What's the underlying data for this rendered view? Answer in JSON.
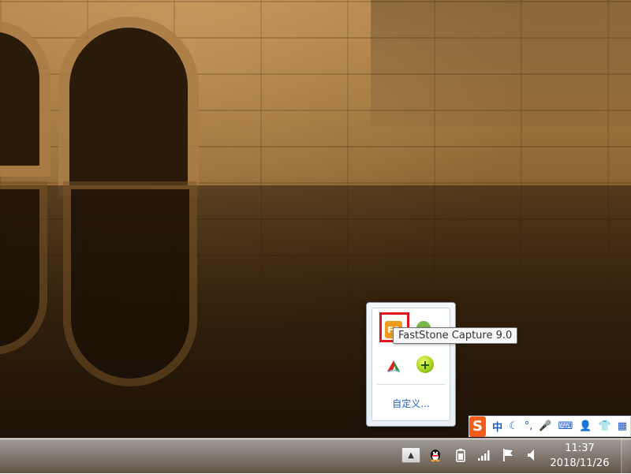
{
  "tray_popup": {
    "icons": [
      {
        "name": "faststone-capture-icon"
      },
      {
        "name": "green-round-icon"
      },
      {
        "name": "red-a-icon"
      },
      {
        "name": "plus-360-icon"
      }
    ],
    "customize_label": "自定义..."
  },
  "tooltip": {
    "text": "FastStone Capture 9.0"
  },
  "ime_bar": {
    "logo": "S",
    "mode": "中",
    "items": [
      "☾",
      "°,",
      "🎤",
      "⌨",
      "👤",
      "👕",
      "▦"
    ]
  },
  "taskbar": {
    "show_hidden_glyph": "▲",
    "clock": {
      "time": "11:37",
      "date": "2018/11/26"
    }
  },
  "colors": {
    "highlight": "#e0121a",
    "link": "#1c5ec6",
    "ime_brand": "#f25c19"
  }
}
